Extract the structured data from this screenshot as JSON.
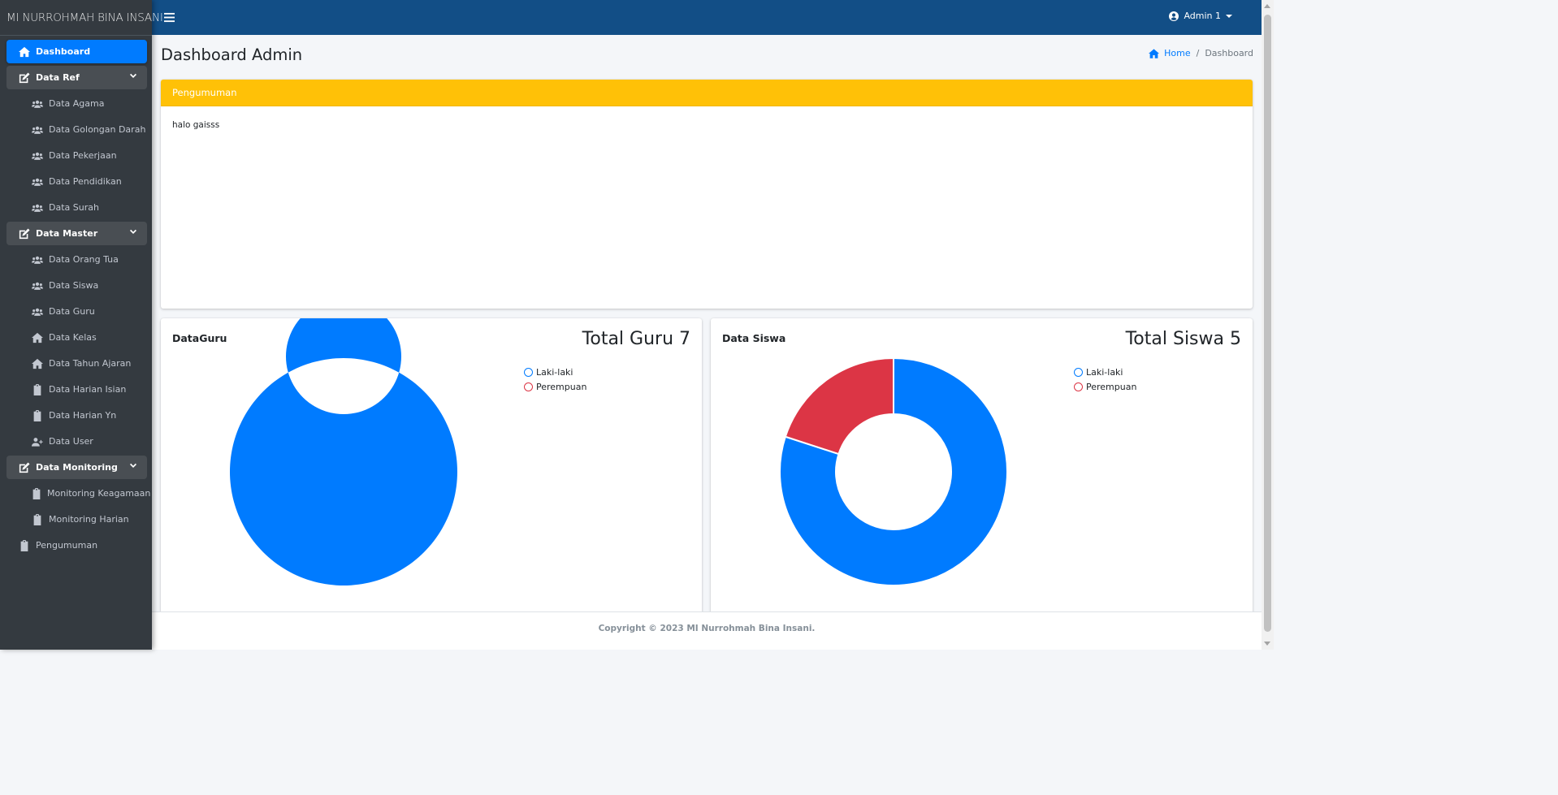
{
  "brand": "MI NURROHMAH BINA INSANI",
  "colors": {
    "primary": "#007bff",
    "navbar": "#124e86",
    "sidebar": "#343a40",
    "warning": "#ffc107",
    "danger": "#dc3545"
  },
  "sidebar": {
    "items": [
      {
        "label": "Dashboard",
        "icon": "home-icon",
        "level": "top",
        "state": "active"
      },
      {
        "label": "Data Ref",
        "icon": "edit-icon",
        "level": "top",
        "state": "open",
        "expandable": true
      },
      {
        "label": "Data Agama",
        "icon": "users-icon",
        "level": "sub"
      },
      {
        "label": "Data Golongan Darah",
        "icon": "users-icon",
        "level": "sub"
      },
      {
        "label": "Data Pekerjaan",
        "icon": "users-icon",
        "level": "sub"
      },
      {
        "label": "Data Pendidikan",
        "icon": "users-icon",
        "level": "sub"
      },
      {
        "label": "Data Surah",
        "icon": "users-icon",
        "level": "sub"
      },
      {
        "label": "Data Master",
        "icon": "edit-icon",
        "level": "top",
        "state": "open",
        "expandable": true
      },
      {
        "label": "Data Orang Tua",
        "icon": "users-icon",
        "level": "sub"
      },
      {
        "label": "Data Siswa",
        "icon": "users-icon",
        "level": "sub"
      },
      {
        "label": "Data Guru",
        "icon": "users-icon",
        "level": "sub"
      },
      {
        "label": "Data Kelas",
        "icon": "home-icon",
        "level": "sub"
      },
      {
        "label": "Data Tahun Ajaran",
        "icon": "home-icon",
        "level": "sub"
      },
      {
        "label": "Data Harian Isian",
        "icon": "clipboard-icon",
        "level": "sub"
      },
      {
        "label": "Data Harian Yn",
        "icon": "clipboard-icon",
        "level": "sub"
      },
      {
        "label": "Data User",
        "icon": "user-plus-icon",
        "level": "sub"
      },
      {
        "label": "Data Monitoring",
        "icon": "edit-icon",
        "level": "top",
        "state": "open",
        "expandable": true
      },
      {
        "label": "Monitoring Keagamaan",
        "icon": "clipboard-icon",
        "level": "sub"
      },
      {
        "label": "Monitoring Harian",
        "icon": "clipboard-icon",
        "level": "sub"
      },
      {
        "label": "Pengumuman",
        "icon": "clipboard-icon",
        "level": "top"
      }
    ]
  },
  "navbar": {
    "user": "Admin 1"
  },
  "page": {
    "title": "Dashboard Admin"
  },
  "breadcrumb": {
    "home": "Home",
    "current": "Dashboard"
  },
  "announcement": {
    "title": "Pengumuman",
    "body": "halo gaisss"
  },
  "charts": {
    "guru": {
      "title": "DataGuru",
      "total_label": "Total Guru 7"
    },
    "siswa": {
      "title": "Data Siswa",
      "total_label": "Total Siswa 5"
    }
  },
  "chart_data": [
    {
      "type": "pie",
      "variant": "doughnut",
      "title": "DataGuru",
      "categories": [
        "Laki-laki",
        "Perempuan"
      ],
      "values": [
        7,
        0
      ],
      "colors": [
        "#007bff",
        "#dc3545"
      ],
      "legend": "top-right"
    },
    {
      "type": "pie",
      "variant": "doughnut",
      "title": "Data Siswa",
      "categories": [
        "Laki-laki",
        "Perempuan"
      ],
      "values": [
        4,
        1
      ],
      "colors": [
        "#007bff",
        "#dc3545"
      ],
      "legend": "top-right"
    }
  ],
  "footer": {
    "text": "Copyright © 2023 MI Nurrohmah Bina Insani."
  }
}
